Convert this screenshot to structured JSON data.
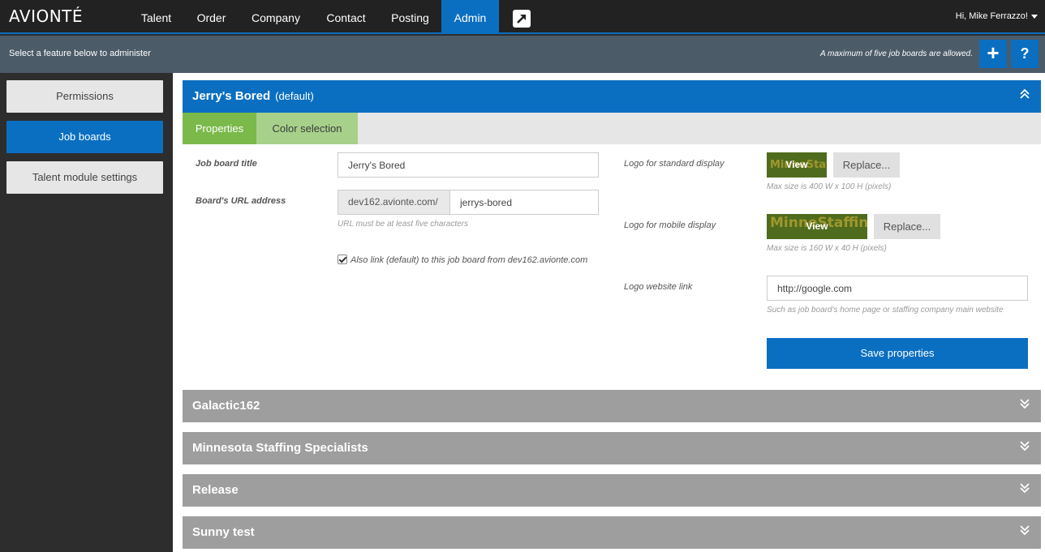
{
  "nav": {
    "logo": "AVIONTÉ",
    "items": [
      {
        "label": "Talent"
      },
      {
        "label": "Order"
      },
      {
        "label": "Company"
      },
      {
        "label": "Contact"
      },
      {
        "label": "Posting"
      },
      {
        "label": "Admin",
        "active": true
      }
    ],
    "user_greeting": "Hi, Mike Ferrazzo!"
  },
  "subbar": {
    "instruction": "Select a feature below to administer",
    "limit_notice": "A maximum of five job boards are allowed.",
    "add_icon": "plus-icon",
    "help_label": "?"
  },
  "sidebar": {
    "items": [
      {
        "label": "Permissions"
      },
      {
        "label": "Job boards",
        "active": true
      },
      {
        "label": "Talent module settings"
      }
    ]
  },
  "boards": {
    "active": {
      "name": "Jerry's Bored",
      "tag": "(default)",
      "tabs": [
        {
          "label": "Properties",
          "active": true
        },
        {
          "label": "Color selection"
        }
      ],
      "properties": {
        "title_label": "Job board title",
        "title_value": "Jerry's Bored",
        "url_label": "Board's URL address",
        "url_prefix": "dev162.avionte.com/",
        "url_value": "jerrys-bored",
        "url_hint": "URL must be at least five characters",
        "also_link_text": "Also link (default) to this job board from dev162.avionte.com",
        "also_link_checked": true,
        "logo_standard_label": "Logo for standard display",
        "logo_standard_hint": "Max size is 400 W x 100 H (pixels)",
        "logo_mobile_label": "Logo for mobile display",
        "logo_mobile_hint": "Max size is 160 W x 40 H (pixels)",
        "logo_brand_text": "MinneStaffing",
        "view_label": "View",
        "replace_label": "Replace...",
        "logo_link_label": "Logo website link",
        "logo_link_value": "http://google.com",
        "logo_link_hint": "Such as job board's home page or staffing company main website",
        "save_label": "Save properties"
      }
    },
    "collapsed": [
      {
        "name": "Galactic162"
      },
      {
        "name": "Minnesota Staffing Specialists"
      },
      {
        "name": "Release"
      },
      {
        "name": "Sunny test"
      }
    ]
  },
  "colors": {
    "primary": "#0b6fc1",
    "tab_active": "#7ab94a",
    "tab_inactive": "#a7d18b",
    "collapsed_header": "#9e9e9e"
  }
}
